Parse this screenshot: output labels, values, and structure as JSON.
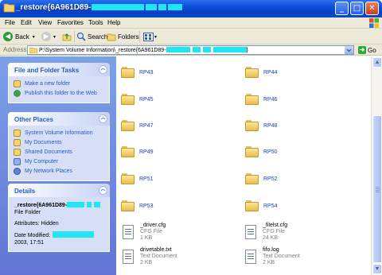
{
  "window": {
    "title": "_restore{6A961D89-",
    "redaction_color": "#1fe6f2",
    "title_bar_color": "#0a4fd8"
  },
  "title_buttons": {
    "minimize": "_",
    "maximize": "□",
    "close": "✕"
  },
  "menu": [
    "File",
    "Edit",
    "View",
    "Favorites",
    "Tools",
    "Help"
  ],
  "toolbar": {
    "back": "Back",
    "search": "Search",
    "folders": "Folders"
  },
  "address": {
    "label": "Address",
    "value": "P:\\System Volume Information\\_restore{6A961D89-",
    "value_end": "}",
    "go": "Go"
  },
  "tasks": {
    "file_folder_tasks": {
      "title": "File and Folder Tasks",
      "items": [
        "Make a new folder",
        "Publish this folder to the Web"
      ]
    },
    "other_places": {
      "title": "Other Places",
      "items": [
        "System Volume Information",
        "My Documents",
        "Shared Documents",
        "My Computer",
        "My Network Places"
      ]
    },
    "details": {
      "title": "Details",
      "name": "_restore{6A961D89-",
      "type": "File Folder",
      "attributes": "Attributes: Hidden",
      "date_label": "Date Modified:",
      "date_value": "2003, 17:51"
    }
  },
  "folders": [
    "RP43",
    "RP44",
    "RP45",
    "RP46",
    "RP47",
    "RP48",
    "RP49",
    "RP50",
    "RP51",
    "RP52",
    "RP53",
    "RP54"
  ],
  "files": [
    {
      "name": "_driver.cfg",
      "type": "CFG File",
      "size": "1 KB"
    },
    {
      "name": "_filelst.cfg",
      "type": "CFG File",
      "size": "24 KB"
    },
    {
      "name": "drivetable.txt",
      "type": "Text Document",
      "size": "2 KB"
    },
    {
      "name": "fifo.log",
      "type": "Text Document",
      "size": "2 KB"
    }
  ],
  "icons": {
    "title": "folder-icon",
    "windows_logo": "windows-logo-icon",
    "back": "back-arrow-icon",
    "forward": "forward-arrow-icon",
    "up": "up-folder-icon",
    "search": "search-icon",
    "folders": "folders-icon",
    "views": "views-icon"
  }
}
